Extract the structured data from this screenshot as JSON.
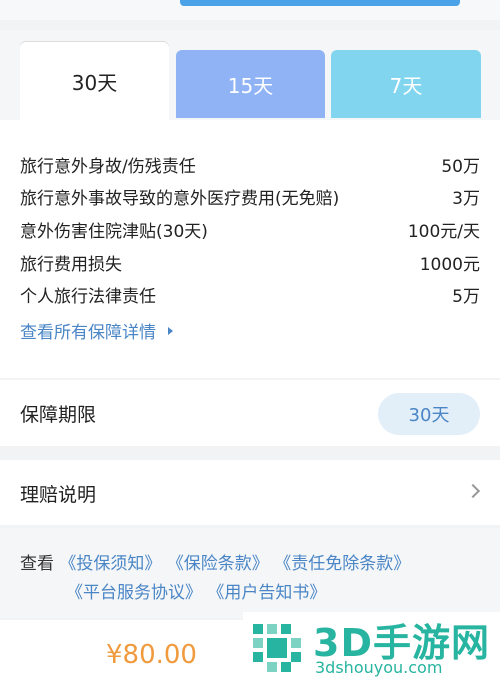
{
  "tabs": [
    {
      "label": "30天"
    },
    {
      "label": "15天"
    },
    {
      "label": "7天"
    }
  ],
  "coverage": {
    "rows": [
      {
        "name": "旅行意外身故/伤残责任",
        "value": "50万"
      },
      {
        "name": "旅行意外事故导致的意外医疗费用(无免赔)",
        "value": "3万"
      },
      {
        "name": "意外伤害住院津贴(30天)",
        "value": "100元/天"
      },
      {
        "name": "旅行费用损失",
        "value": "1000元"
      },
      {
        "name": "个人旅行法律责任",
        "value": "5万"
      }
    ],
    "details_link": "查看所有保障详情"
  },
  "period": {
    "label": "保障期限",
    "value": "30天"
  },
  "claims": {
    "label": "理赔说明"
  },
  "terms": {
    "prefix": "查看",
    "link1": "《投保须知》",
    "link2": "《保险条款》",
    "link3": "《责任免除条款》",
    "link4": "《平台服务协议》",
    "link5": "《用户告知书》"
  },
  "footer": {
    "price": "¥80.00"
  },
  "watermark": {
    "big": "3D手游网",
    "small": "3dshouyou.com"
  },
  "colors": {
    "accent": "#4a86c6",
    "price": "#f09a3e",
    "watermark": "#27b4a0"
  }
}
